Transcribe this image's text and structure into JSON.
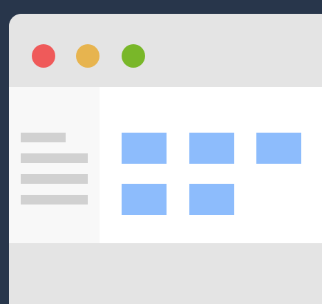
{
  "colors": {
    "background": "#28364b",
    "window_chrome": "#e4e4e4",
    "sidebar": "#f8f8f8",
    "content": "#ffffff",
    "sidebar_line": "#d1d1d1",
    "tile": "#8dbcfc",
    "close": "#ef5a5a",
    "minimize": "#e7b44f",
    "maximize": "#79b729"
  },
  "window": {
    "controls": [
      {
        "name": "close-icon",
        "color_key": "close"
      },
      {
        "name": "minimize-icon",
        "color_key": "minimize"
      },
      {
        "name": "maximize-icon",
        "color_key": "maximize"
      }
    ],
    "sidebar_items": 4,
    "tiles": 5
  }
}
